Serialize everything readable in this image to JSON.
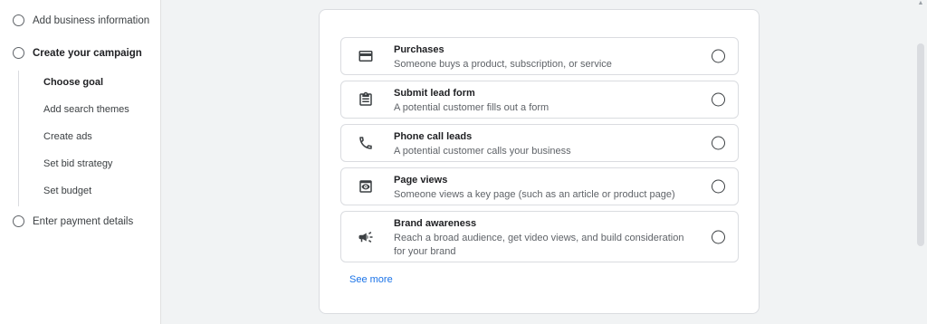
{
  "stepper": {
    "steps": [
      {
        "label": "Add business information"
      },
      {
        "label": "Create your campaign"
      },
      {
        "label": "Enter payment details"
      }
    ],
    "substeps": [
      {
        "label": "Choose goal"
      },
      {
        "label": "Add search themes"
      },
      {
        "label": "Create ads"
      },
      {
        "label": "Set bid strategy"
      },
      {
        "label": "Set budget"
      }
    ]
  },
  "goals": {
    "options": [
      {
        "title": "Purchases",
        "description": "Someone buys a product, subscription, or service",
        "icon": "credit-card-icon"
      },
      {
        "title": "Submit lead form",
        "description": "A potential customer fills out a form",
        "icon": "clipboard-icon"
      },
      {
        "title": "Phone call leads",
        "description": "A potential customer calls your business",
        "icon": "phone-icon"
      },
      {
        "title": "Page views",
        "description": "Someone views a key page (such as an article or product page)",
        "icon": "eye-page-icon"
      },
      {
        "title": "Brand awareness",
        "description": "Reach a broad audience, get video views, and build consideration for your brand",
        "icon": "megaphone-icon"
      }
    ],
    "see_more": "See more"
  },
  "colors": {
    "link": "#1a73e8",
    "text": "#3c4043",
    "border": "#dadce0",
    "background": "#f1f3f4"
  }
}
